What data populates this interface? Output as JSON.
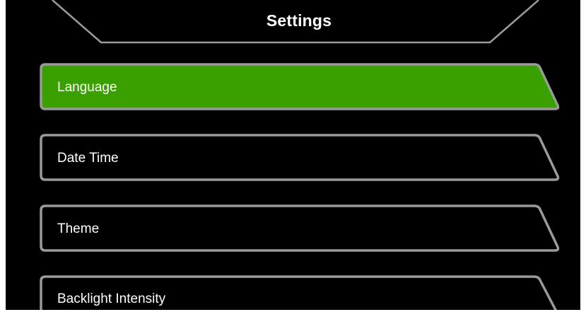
{
  "header": {
    "title": "Settings"
  },
  "menu": {
    "items": [
      {
        "label": "Language",
        "selected": true
      },
      {
        "label": "Date Time",
        "selected": false
      },
      {
        "label": "Theme",
        "selected": false
      },
      {
        "label": "Backlight Intensity",
        "selected": false
      }
    ]
  },
  "colors": {
    "background": "#000000",
    "selected_fill": "#3aa000",
    "border": "#9a9a9a",
    "text": "#ffffff"
  }
}
